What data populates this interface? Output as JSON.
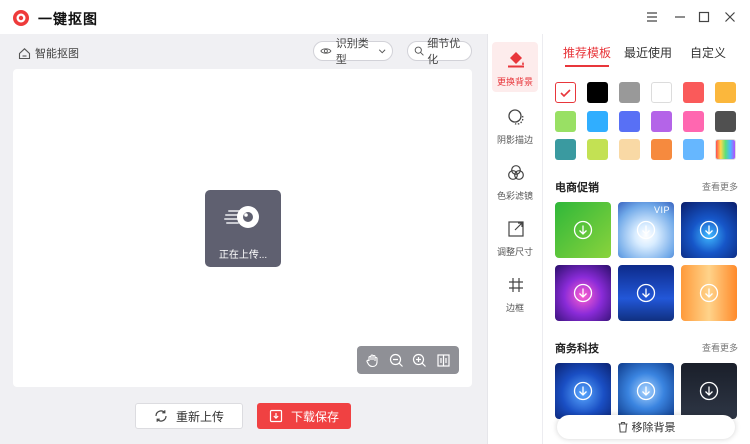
{
  "app": {
    "title": "一键抠图"
  },
  "header": {
    "breadcrumb": "智能抠图",
    "recognize_type": "识别类型",
    "detail_optimize": "细节优化"
  },
  "canvas": {
    "upload_status": "正在上传..."
  },
  "actions": {
    "reupload": "重新上传",
    "download": "下载保存"
  },
  "tools": [
    {
      "label": "更换背景",
      "icon": "paint-bucket-icon"
    },
    {
      "label": "阴影描边",
      "icon": "shadow-icon"
    },
    {
      "label": "色彩滤镜",
      "icon": "color-filter-icon"
    },
    {
      "label": "调整尺寸",
      "icon": "resize-icon"
    },
    {
      "label": "边框",
      "icon": "border-icon"
    }
  ],
  "panel": {
    "tabs": [
      "推荐模板",
      "最近使用",
      "自定义"
    ],
    "active_tab": "推荐模板",
    "colors": [
      "#ffffff",
      "#000000",
      "#999999",
      "#ffffff",
      "#fa5a5a",
      "#fbb73c",
      "#99e064",
      "#30aeff",
      "#5870f5",
      "#b464e8",
      "#ff67b0",
      "#505050",
      "#3a9aa0",
      "#c3e153",
      "#f9d9a5",
      "#f68a3e",
      "#66b7ff",
      "gradient"
    ],
    "sections": [
      {
        "title": "电商促销",
        "more": "查看更多",
        "vip_label": "VIP"
      },
      {
        "title": "商务科技",
        "more": "查看更多"
      }
    ],
    "remove_bg": "移除背景"
  },
  "colors": {
    "accent": "#e8363b",
    "primary_button": "#f04142"
  }
}
